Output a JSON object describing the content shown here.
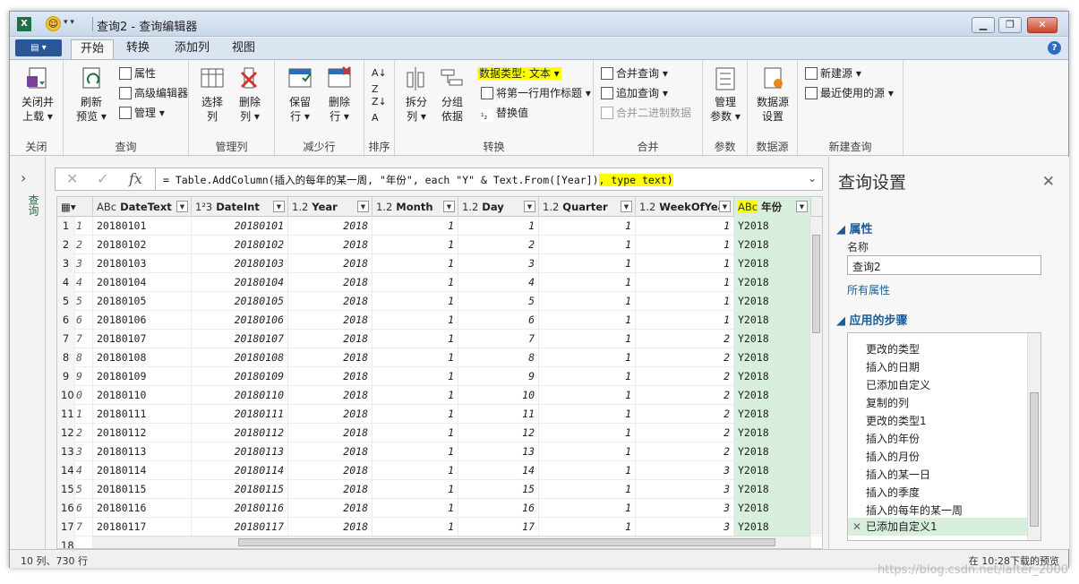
{
  "window": {
    "title": "查询2 - 查询编辑器",
    "app_icon": "X",
    "controls": [
      "▁",
      "❐",
      "✕"
    ]
  },
  "tabs": [
    {
      "label": "开始",
      "active": true
    },
    {
      "label": "转换",
      "active": false
    },
    {
      "label": "添加列",
      "active": false
    },
    {
      "label": "视图",
      "active": false
    }
  ],
  "file_button": "▤ ▾",
  "ribbon": {
    "close_group": {
      "label": "关闭",
      "close_load": "关闭并\n上载 ▾"
    },
    "query_group": {
      "label": "查询",
      "refresh": "刷新\n预览 ▾",
      "properties": "属性",
      "advanced_editor": "高级编辑器",
      "manage": "管理 ▾"
    },
    "manage_cols": {
      "label": "管理列",
      "choose": "选择\n列",
      "remove": "删除\n列 ▾"
    },
    "reduce_rows": {
      "label": "减少行",
      "keep": "保留\n行 ▾",
      "remove": "删除\n行 ▾"
    },
    "sort": {
      "label": "排序"
    },
    "transform": {
      "label": "转换",
      "split": "拆分\n列 ▾",
      "group": "分组\n依据",
      "datatype": "数据类型: 文本 ▾",
      "first_row": "将第一行用作标题 ▾",
      "replace": "替换值"
    },
    "combine": {
      "label": "合并",
      "merge": "合并查询 ▾",
      "append": "追加查询 ▾",
      "binary": "合并二进制数据"
    },
    "params": {
      "label": "参数",
      "manage": "管理\n参数 ▾"
    },
    "datasource": {
      "label": "数据源",
      "settings": "数据源\n设置"
    },
    "newquery": {
      "label": "新建查询",
      "new_source": "新建源 ▾",
      "recent": "最近使用的源 ▾"
    }
  },
  "left_panel": {
    "chevron": "›",
    "label": "查询"
  },
  "formula": {
    "main": "= Table.AddColumn(插入的每年的某一周, \"年份\", each \"Y\" & Text.From([Year])",
    "highlighted": ", type text)",
    "cancel_icon": "✕",
    "confirm_icon": "✓",
    "fx": "fx",
    "expand": "⌄"
  },
  "grid": {
    "columns": [
      {
        "type": "ABᴄ",
        "name": "DateText"
      },
      {
        "type": "1²3",
        "name": "DateInt"
      },
      {
        "type": "1.2",
        "name": "Year"
      },
      {
        "type": "1.2",
        "name": "Month"
      },
      {
        "type": "1.2",
        "name": "Day"
      },
      {
        "type": "1.2",
        "name": "Quarter"
      },
      {
        "type": "1.2",
        "name": "WeekOfYear"
      },
      {
        "type": "ABᴄ",
        "name": "年份"
      }
    ],
    "rows": [
      {
        "n": "1",
        "i": "1",
        "text": "20180101",
        "int": "20180101",
        "year": "2018",
        "month": "1",
        "day": "1",
        "q": "1",
        "w": "1",
        "yy": "Y2018"
      },
      {
        "n": "2",
        "i": "2",
        "text": "20180102",
        "int": "20180102",
        "year": "2018",
        "month": "1",
        "day": "2",
        "q": "1",
        "w": "1",
        "yy": "Y2018"
      },
      {
        "n": "3",
        "i": "3",
        "text": "20180103",
        "int": "20180103",
        "year": "2018",
        "month": "1",
        "day": "3",
        "q": "1",
        "w": "1",
        "yy": "Y2018"
      },
      {
        "n": "4",
        "i": "4",
        "text": "20180104",
        "int": "20180104",
        "year": "2018",
        "month": "1",
        "day": "4",
        "q": "1",
        "w": "1",
        "yy": "Y2018"
      },
      {
        "n": "5",
        "i": "5",
        "text": "20180105",
        "int": "20180105",
        "year": "2018",
        "month": "1",
        "day": "5",
        "q": "1",
        "w": "1",
        "yy": "Y2018"
      },
      {
        "n": "6",
        "i": "6",
        "text": "20180106",
        "int": "20180106",
        "year": "2018",
        "month": "1",
        "day": "6",
        "q": "1",
        "w": "1",
        "yy": "Y2018"
      },
      {
        "n": "7",
        "i": "7",
        "text": "20180107",
        "int": "20180107",
        "year": "2018",
        "month": "1",
        "day": "7",
        "q": "1",
        "w": "2",
        "yy": "Y2018"
      },
      {
        "n": "8",
        "i": "8",
        "text": "20180108",
        "int": "20180108",
        "year": "2018",
        "month": "1",
        "day": "8",
        "q": "1",
        "w": "2",
        "yy": "Y2018"
      },
      {
        "n": "9",
        "i": "9",
        "text": "20180109",
        "int": "20180109",
        "year": "2018",
        "month": "1",
        "day": "9",
        "q": "1",
        "w": "2",
        "yy": "Y2018"
      },
      {
        "n": "10",
        "i": "0",
        "text": "20180110",
        "int": "20180110",
        "year": "2018",
        "month": "1",
        "day": "10",
        "q": "1",
        "w": "2",
        "yy": "Y2018"
      },
      {
        "n": "11",
        "i": "1",
        "text": "20180111",
        "int": "20180111",
        "year": "2018",
        "month": "1",
        "day": "11",
        "q": "1",
        "w": "2",
        "yy": "Y2018"
      },
      {
        "n": "12",
        "i": "2",
        "text": "20180112",
        "int": "20180112",
        "year": "2018",
        "month": "1",
        "day": "12",
        "q": "1",
        "w": "2",
        "yy": "Y2018"
      },
      {
        "n": "13",
        "i": "3",
        "text": "20180113",
        "int": "20180113",
        "year": "2018",
        "month": "1",
        "day": "13",
        "q": "1",
        "w": "2",
        "yy": "Y2018"
      },
      {
        "n": "14",
        "i": "4",
        "text": "20180114",
        "int": "20180114",
        "year": "2018",
        "month": "1",
        "day": "14",
        "q": "1",
        "w": "3",
        "yy": "Y2018"
      },
      {
        "n": "15",
        "i": "5",
        "text": "20180115",
        "int": "20180115",
        "year": "2018",
        "month": "1",
        "day": "15",
        "q": "1",
        "w": "3",
        "yy": "Y2018"
      },
      {
        "n": "16",
        "i": "6",
        "text": "20180116",
        "int": "20180116",
        "year": "2018",
        "month": "1",
        "day": "16",
        "q": "1",
        "w": "3",
        "yy": "Y2018"
      },
      {
        "n": "17",
        "i": "7",
        "text": "20180117",
        "int": "20180117",
        "year": "2018",
        "month": "1",
        "day": "17",
        "q": "1",
        "w": "3",
        "yy": "Y2018"
      },
      {
        "n": "18",
        "i": "",
        "text": "",
        "int": "",
        "year": "",
        "month": "",
        "day": "",
        "q": "",
        "w": "",
        "yy": ""
      }
    ]
  },
  "status": {
    "left": "10 列、730 行",
    "right": "在 10:28下载的预览"
  },
  "query_settings": {
    "title": "查询设置",
    "close": "✕",
    "properties_section": "◢ 属性",
    "name_label": "名称",
    "name_value": "查询2",
    "all_properties": "所有属性",
    "steps_section": "◢ 应用的步骤",
    "steps": [
      "更改的类型",
      "插入的日期",
      "已添加自定义",
      "复制的列",
      "更改的类型1",
      "插入的年份",
      "插入的月份",
      "插入的某一日",
      "插入的季度",
      "插入的每年的某一周"
    ],
    "active_step": "已添加自定义1",
    "active_step_icon": "✕"
  },
  "watermark": "https://blog.csdn.net/lafter_2000",
  "colors": {
    "highlight": "#ffff00",
    "selected_col": "#d9efde",
    "link": "#1e5c96"
  }
}
